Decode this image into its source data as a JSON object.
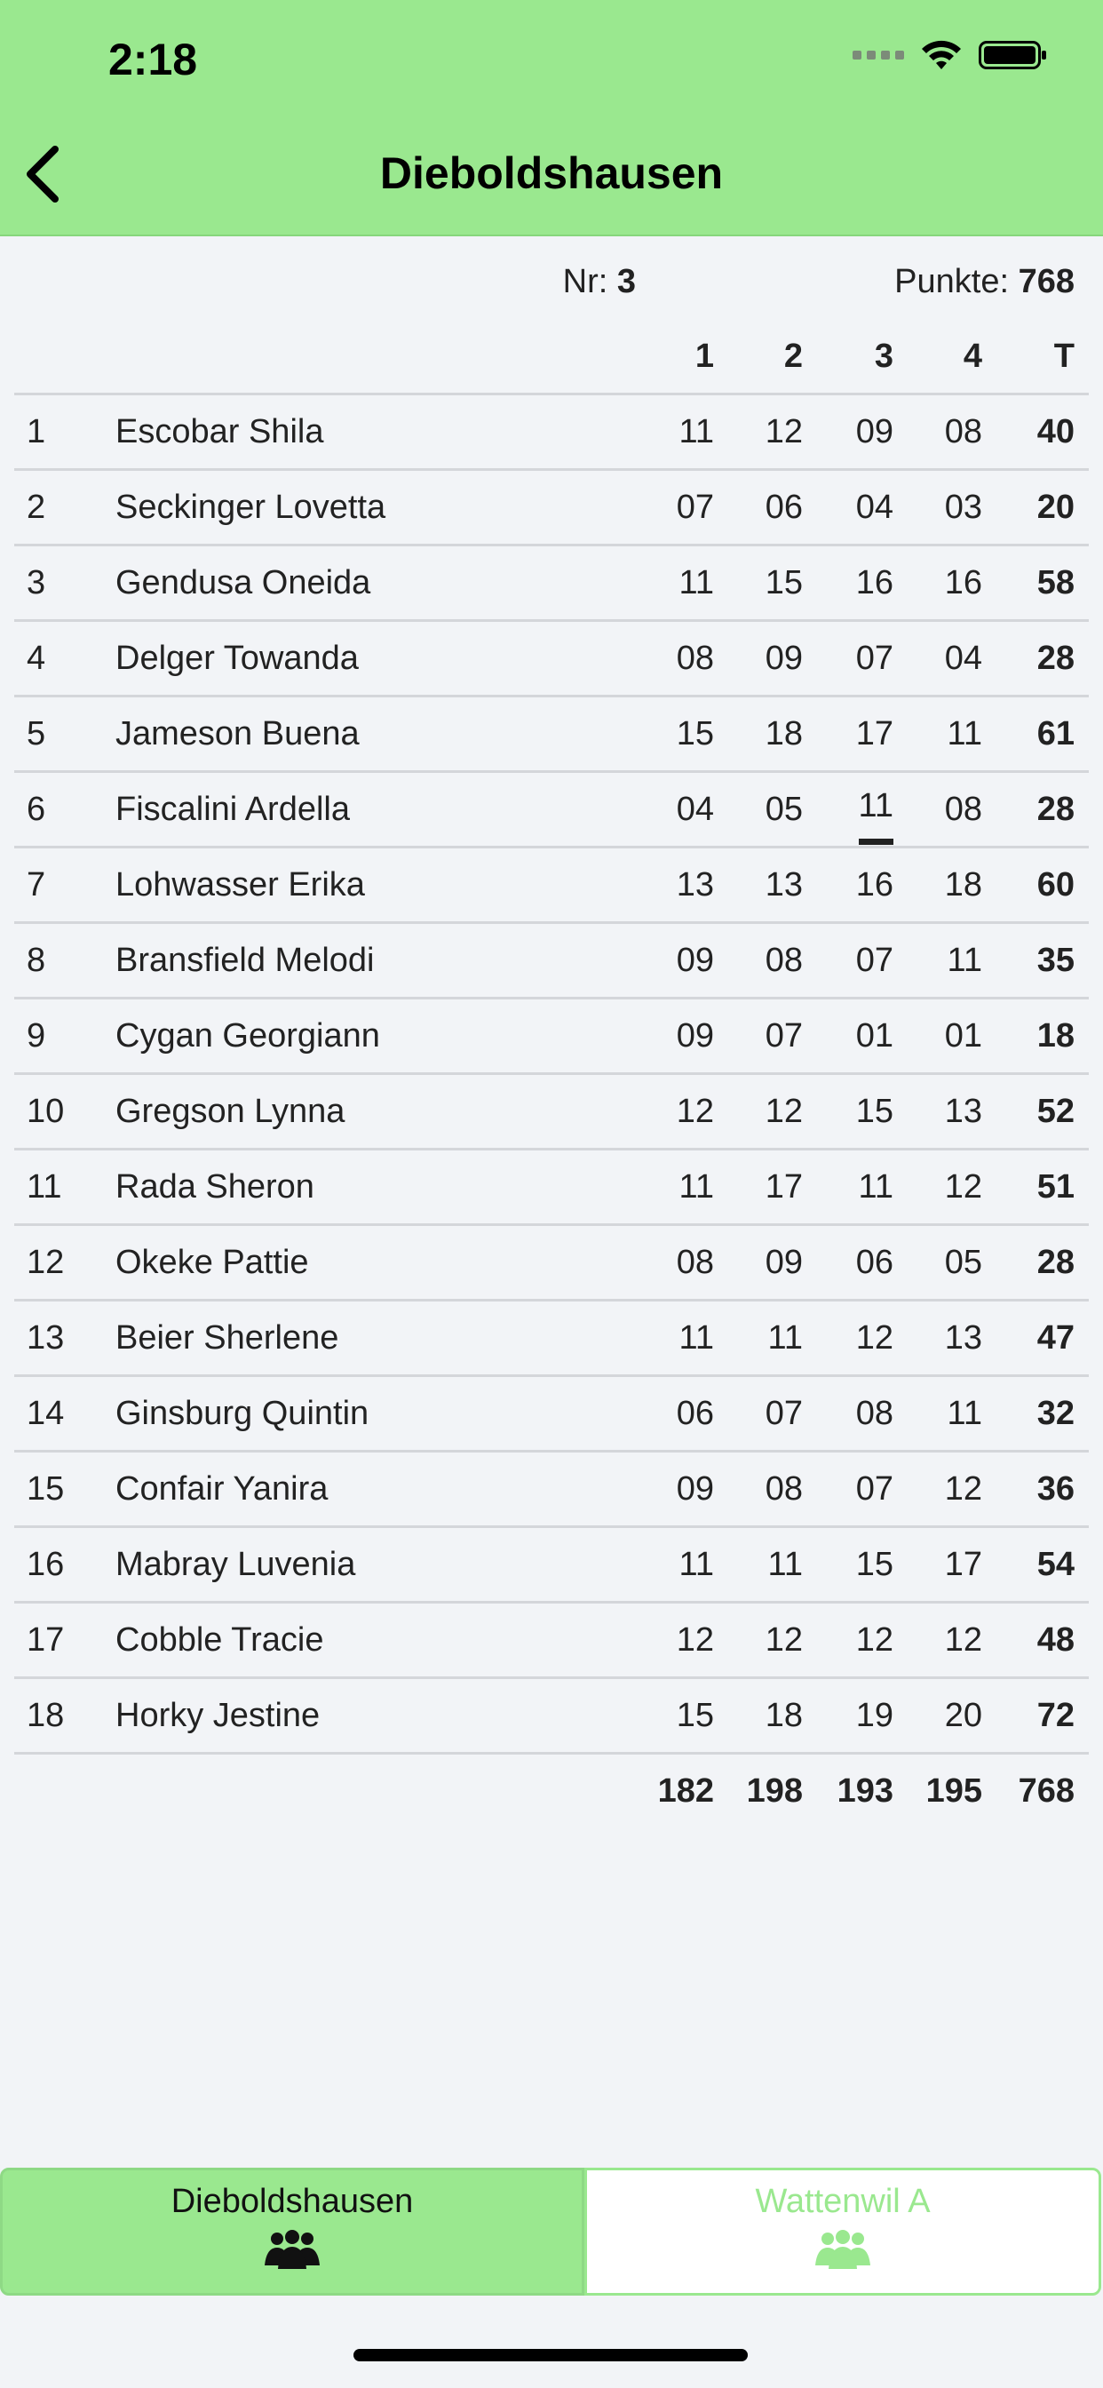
{
  "status_bar": {
    "time": "2:18"
  },
  "nav": {
    "title": "Dieboldshausen"
  },
  "info": {
    "nr_label": "Nr: ",
    "nr_value": "3",
    "points_label": "Punkte: ",
    "points_value": "768"
  },
  "table": {
    "headers": [
      "1",
      "2",
      "3",
      "4",
      "T"
    ],
    "rows": [
      {
        "rank": "1",
        "name": "Escobar Shila",
        "r1": "11",
        "r2": "12",
        "r3": "09",
        "r4": "08",
        "t": "40"
      },
      {
        "rank": "2",
        "name": "Seckinger Lovetta",
        "r1": "07",
        "r2": "06",
        "r3": "04",
        "r4": "03",
        "t": "20"
      },
      {
        "rank": "3",
        "name": "Gendusa Oneida",
        "r1": "11",
        "r2": "15",
        "r3": "16",
        "r4": "16",
        "t": "58"
      },
      {
        "rank": "4",
        "name": "Delger Towanda",
        "r1": "08",
        "r2": "09",
        "r3": "07",
        "r4": "04",
        "t": "28"
      },
      {
        "rank": "5",
        "name": "Jameson Buena",
        "r1": "15",
        "r2": "18",
        "r3": "17",
        "r4": "11",
        "t": "61"
      },
      {
        "rank": "6",
        "name": "Fiscalini Ardella",
        "r1": "04",
        "r2": "05",
        "r3": "11",
        "r4": "08",
        "t": "28"
      },
      {
        "rank": "7",
        "name": "Lohwasser Erika",
        "r1": "13",
        "r2": "13",
        "r3": "16",
        "r4": "18",
        "t": "60"
      },
      {
        "rank": "8",
        "name": "Bransfield Melodi",
        "r1": "09",
        "r2": "08",
        "r3": "07",
        "r4": "11",
        "t": "35"
      },
      {
        "rank": "9",
        "name": "Cygan Georgiann",
        "r1": "09",
        "r2": "07",
        "r3": "01",
        "r4": "01",
        "t": "18"
      },
      {
        "rank": "10",
        "name": "Gregson Lynna",
        "r1": "12",
        "r2": "12",
        "r3": "15",
        "r4": "13",
        "t": "52"
      },
      {
        "rank": "11",
        "name": "Rada Sheron",
        "r1": "11",
        "r2": "17",
        "r3": "11",
        "r4": "12",
        "t": "51"
      },
      {
        "rank": "12",
        "name": "Okeke Pattie",
        "r1": "08",
        "r2": "09",
        "r3": "06",
        "r4": "05",
        "t": "28"
      },
      {
        "rank": "13",
        "name": "Beier Sherlene",
        "r1": "11",
        "r2": "11",
        "r3": "12",
        "r4": "13",
        "t": "47"
      },
      {
        "rank": "14",
        "name": "Ginsburg Quintin",
        "r1": "06",
        "r2": "07",
        "r3": "08",
        "r4": "11",
        "t": "32"
      },
      {
        "rank": "15",
        "name": "Confair Yanira",
        "r1": "09",
        "r2": "08",
        "r3": "07",
        "r4": "12",
        "t": "36"
      },
      {
        "rank": "16",
        "name": "Mabray Luvenia",
        "r1": "11",
        "r2": "11",
        "r3": "15",
        "r4": "17",
        "t": "54"
      },
      {
        "rank": "17",
        "name": "Cobble Tracie",
        "r1": "12",
        "r2": "12",
        "r3": "12",
        "r4": "12",
        "t": "48"
      },
      {
        "rank": "18",
        "name": "Horky Jestine",
        "r1": "15",
        "r2": "18",
        "r3": "19",
        "r4": "20",
        "t": "72"
      }
    ],
    "totals": [
      "182",
      "198",
      "193",
      "195",
      "768"
    ]
  },
  "tabs": [
    {
      "label": "Dieboldshausen",
      "icon": "team-icon",
      "active": true
    },
    {
      "label": "Wattenwil A",
      "icon": "team-icon",
      "active": false
    }
  ],
  "colors": {
    "accent": "#9ae88f",
    "background": "#f2f4f7"
  }
}
